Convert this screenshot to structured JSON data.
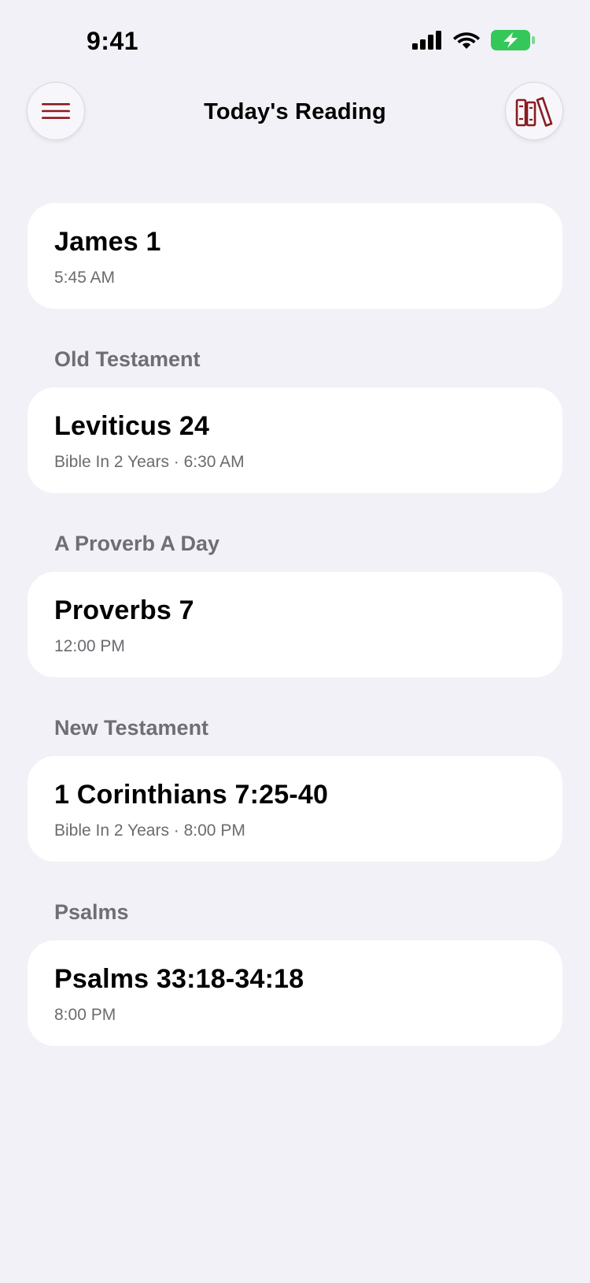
{
  "status_bar": {
    "time": "9:41",
    "icons": [
      "cellular-signal-icon",
      "wifi-icon",
      "battery-charging-icon"
    ],
    "battery_color": "#34c759"
  },
  "header": {
    "title": "Today's Reading",
    "left_button_icon": "hamburger-menu-icon",
    "right_button_icon": "library-books-icon",
    "accent_color": "#8b1a1f"
  },
  "readings": {
    "top": {
      "title": "James 1",
      "subtitle": "5:45 AM"
    },
    "sections": [
      {
        "label": "Old Testament",
        "title": "Leviticus 24",
        "subtitle": "Bible In 2 Years · 6:30 AM"
      },
      {
        "label": "A Proverb A Day",
        "title": "Proverbs 7",
        "subtitle": "12:00 PM"
      },
      {
        "label": "New Testament",
        "title": "1 Corinthians 7:25-40",
        "subtitle": "Bible In 2 Years · 8:00 PM"
      },
      {
        "label": "Psalms",
        "title": "Psalms 33:18-34:18",
        "subtitle": "8:00 PM"
      }
    ]
  }
}
